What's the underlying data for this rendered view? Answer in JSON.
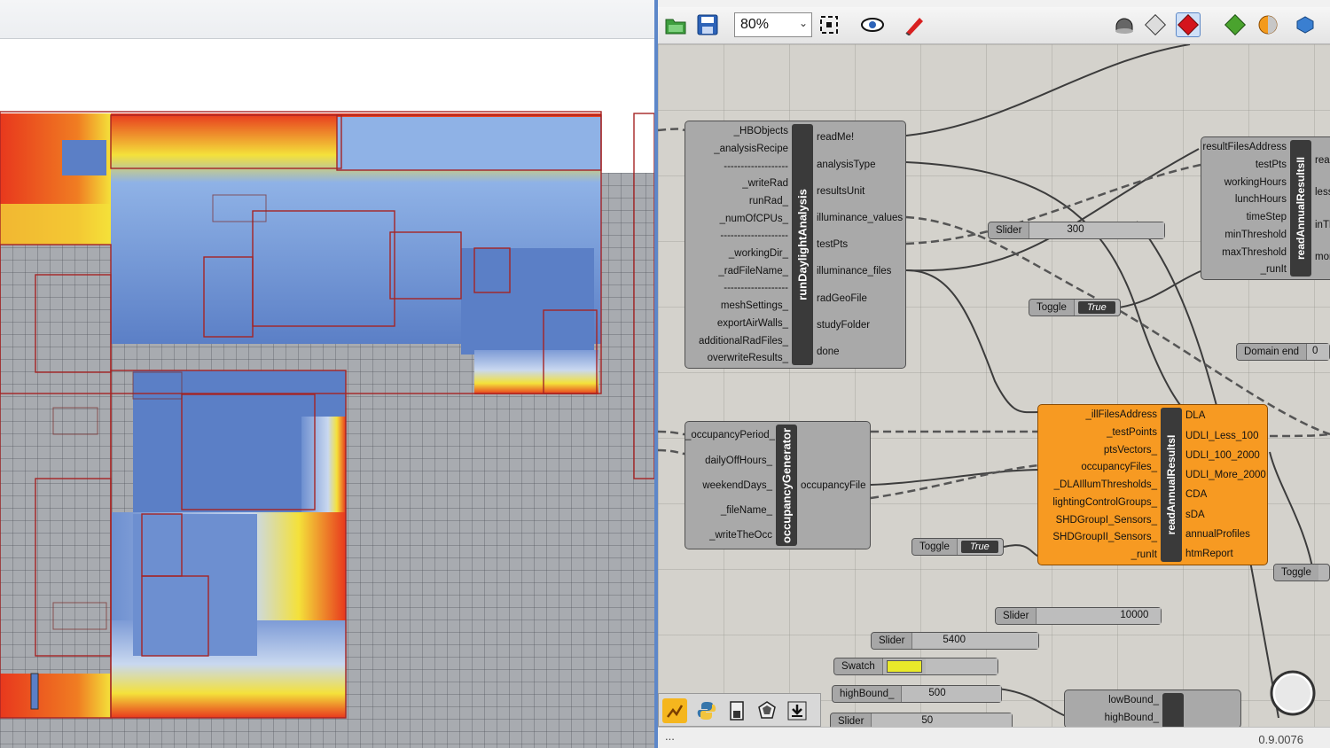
{
  "toolbar": {
    "zoom": "80%",
    "icons": [
      "open-file-icon",
      "save-icon",
      "zoom-extents-icon",
      "preview-eye-icon",
      "sketch-pen-icon",
      "preview-wire-icon",
      "preview-mesh-icon",
      "preview-shaded-icon",
      "sphere-shaded-icon",
      "bake-icon",
      "globe-icon"
    ]
  },
  "components": {
    "runDaylight": {
      "title": "runDaylightAnalysis",
      "inputs": [
        "_HBObjects",
        "_analysisRecipe",
        "-------------------",
        "_writeRad",
        "runRad_",
        "_numOfCPUs_",
        "--------------------",
        "_workingDir_",
        "_radFileName_",
        "-------------------",
        "meshSettings_",
        "exportAirWalls_",
        "additionalRadFiles_",
        "overwriteResults_"
      ],
      "outputs": [
        "readMe!",
        "analysisType",
        "resultsUnit",
        "illuminance_values",
        "testPts",
        "illuminance_files",
        "radGeoFile",
        "studyFolder",
        "done"
      ]
    },
    "readAnnualII": {
      "title": "readAnnualResultsII",
      "inputs": [
        "resultFilesAddress",
        "testPts",
        "workingHours",
        "lunchHours",
        "timeStep",
        "minThreshold",
        "maxThreshold",
        "_runIt"
      ],
      "outputs": [
        "read",
        "less",
        "inTh",
        "mor"
      ]
    },
    "occupancy": {
      "title": "occupancyGenerator",
      "inputs": [
        "_occupancyPeriod_",
        "dailyOffHours_",
        "weekendDays_",
        "_fileName_",
        "_writeTheOcc"
      ],
      "outputs": [
        "occupancyFile"
      ]
    },
    "readAnnualI": {
      "title": "readAnnualResultsI",
      "inputs": [
        "_illFilesAddress",
        "_testPoints",
        "ptsVectors_",
        "occupancyFiles_",
        "_DLAIllumThresholds_",
        "lightingControlGroups_",
        "SHDGroupI_Sensors_",
        "SHDGroupII_Sensors_",
        "_runIt"
      ],
      "outputs": [
        "DLA",
        "UDLI_Less_100",
        "UDLI_100_2000",
        "UDLI_More_2000",
        "CDA",
        "sDA",
        "annualProfiles",
        "htmReport"
      ]
    },
    "bottomComp": {
      "inputs": [
        "lowBound_",
        "highBound_"
      ]
    }
  },
  "widgets": {
    "slider300": {
      "label": "Slider",
      "value": "300"
    },
    "toggle1": {
      "label": "Toggle",
      "value": "True"
    },
    "domainEnd": {
      "label": "Domain end",
      "value": "0"
    },
    "toggle2": {
      "label": "Toggle",
      "value": "True"
    },
    "toggle3": {
      "label": "Toggle"
    },
    "slider10000": {
      "label": "Slider",
      "value": "10000"
    },
    "slider5400": {
      "label": "Slider",
      "value": "5400"
    },
    "swatch": {
      "label": "Swatch",
      "color": "#eaea2a"
    },
    "highBound": {
      "label": "highBound_",
      "value": "500"
    },
    "slider50": {
      "label": "Slider",
      "value": "50"
    }
  },
  "bottombar": {
    "icons": [
      "ladybug-icon",
      "python-icon",
      "file-icon",
      "gem-icon",
      "download-icon"
    ]
  },
  "status": {
    "left": "...",
    "version": "0.9.0076"
  },
  "colors": {
    "accent_divider": "#5d87c9",
    "component_orange": "#f79a22",
    "heat_red": "#e8381d",
    "heat_yellow": "#f4e13a",
    "heat_blue": "#5b7fc6"
  }
}
